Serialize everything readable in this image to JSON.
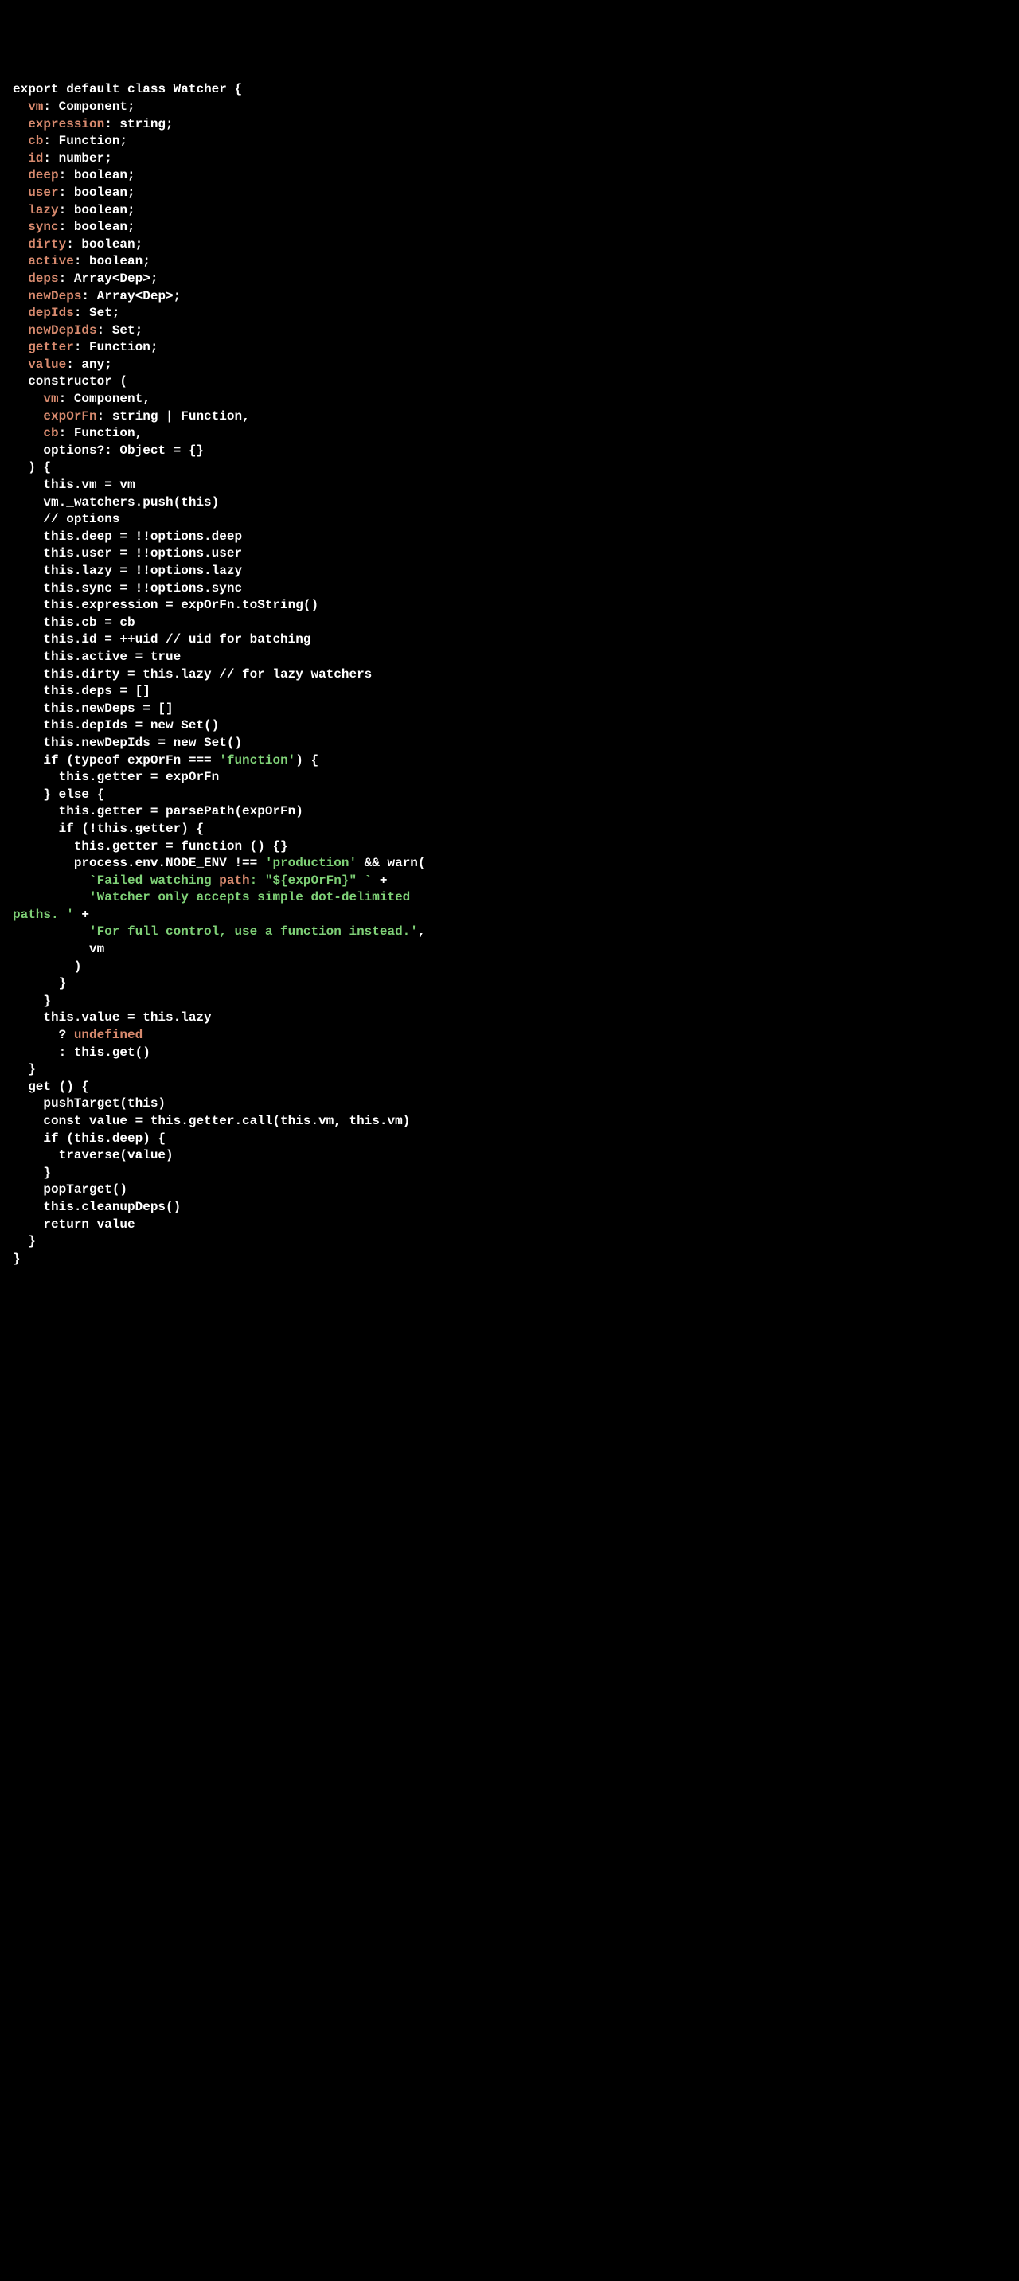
{
  "code": {
    "kw_export": "export",
    "kw_default": "default",
    "kw_class": "class",
    "cls_watcher": "Watcher",
    "brace_open": "{",
    "brace_close": "}",
    "props": {
      "vm": "vm",
      "vm_t": "Component",
      "expression": "expression",
      "expression_t": "string",
      "cb": "cb",
      "cb_t": "Function",
      "id": "id",
      "id_t": "number",
      "deep": "deep",
      "deep_t": "boolean",
      "user": "user",
      "user_t": "boolean",
      "lazy": "lazy",
      "lazy_t": "boolean",
      "sync": "sync",
      "sync_t": "boolean",
      "dirty": "dirty",
      "dirty_t": "boolean",
      "active": "active",
      "active_t": "boolean",
      "deps": "deps",
      "deps_t": "Array<Dep>",
      "newDeps": "newDeps",
      "newDeps_t": "Array<Dep>",
      "depIds": "depIds",
      "depIds_t": "Set",
      "newDepIds": "newDepIds",
      "newDepIds_t": "Set",
      "getter": "getter",
      "getter_t": "Function",
      "value": "value",
      "value_t": "any"
    },
    "ctor": {
      "kw": "constructor",
      "p_vm": "vm",
      "p_vm_t": "Component",
      "p_exp": "expOrFn",
      "p_exp_t": "string | Function",
      "p_cb": "cb",
      "p_cb_t": "Function",
      "p_opt": "options?",
      "p_opt_t": "Object = {}",
      "l_this_vm": "this.vm = vm",
      "l_push": "vm._watchers.push(this)",
      "l_c_options": "// options",
      "l_deep": "this.deep = !!options.deep",
      "l_user": "this.user = !!options.user",
      "l_lazy": "this.lazy = !!options.lazy",
      "l_sync": "this.sync = !!options.sync",
      "l_expr": "this.expression = expOrFn.toString()",
      "l_cb": "this.cb = cb",
      "l_id": "this.id = ++uid // uid for batching",
      "l_active": "this.active = true",
      "l_dirty": "this.dirty = this.lazy // for lazy watchers",
      "l_deps": "this.deps = []",
      "l_newDeps": "this.newDeps = []",
      "l_depIds": "this.depIds = new Set()",
      "l_newDepIds": "this.newDepIds = new Set()",
      "l_if_typeof_pre": "if (typeof expOrFn === ",
      "l_if_typeof_str": "'function'",
      "l_if_typeof_post": ") {",
      "l_getter_fn": "this.getter = expOrFn",
      "l_else": "} else {",
      "l_parse": "this.getter = parsePath(expOrFn)",
      "l_if_not_getter": "if (!this.getter) {",
      "l_noop": "this.getter = function () {}",
      "l_env_pre": "process.env.NODE_ENV !== ",
      "l_env_str": "'production'",
      "l_env_post": " && warn(",
      "l_str1_pre": "`Failed watching ",
      "l_str1_path": "path",
      "l_str1_post": ": \"${expOrFn}\" `",
      "l_plus": " +",
      "l_str2": "'Watcher only accepts simple dot-delimited paths. '",
      "l_str2_cont": "paths. '",
      "l_str2_pre": "'Watcher only accepts simple dot-delimited ",
      "l_str3": "'For full control, use a function instead.'",
      "l_comma": ",",
      "l_vm_arg": "vm",
      "l_paren_close": ")",
      "l_value_pre": "this.value = this.lazy",
      "l_tern_undef_pre": "? ",
      "l_tern_undef": "undefined",
      "l_tern_get": ": this.get()"
    },
    "get": {
      "kw": "get",
      "sig": " () {",
      "l_push": "pushTarget(this)",
      "l_const": "const value = this.getter.call(this.vm, this.vm)",
      "l_if_deep": "if (this.deep) {",
      "l_traverse": "traverse(value)",
      "l_pop": "popTarget()",
      "l_clean": "this.cleanupDeps()",
      "l_return": "return value"
    }
  }
}
